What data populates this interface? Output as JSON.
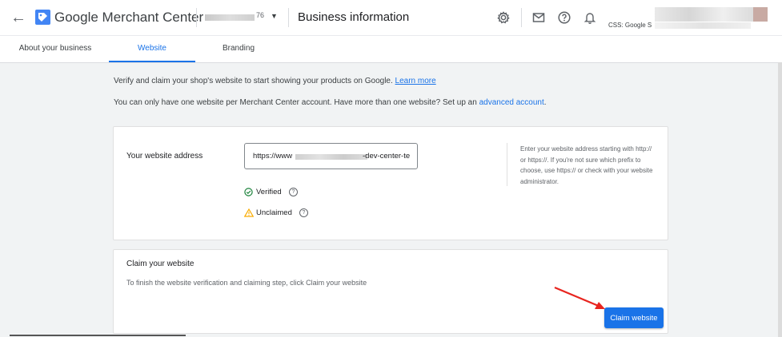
{
  "header": {
    "back_icon": "arrow-back-icon",
    "logo_icon": "merchant-center-logo-icon",
    "brand": "Google Merchant Center",
    "account_suffix": "76",
    "page_title": "Business information",
    "icons": [
      "settings-gear-icon",
      "mail-icon",
      "help-icon",
      "notifications-bell-icon"
    ],
    "profile_label": "CSS: Google S"
  },
  "tabs": [
    {
      "label": "About your business",
      "active": false
    },
    {
      "label": "Website",
      "active": true
    },
    {
      "label": "Branding",
      "active": false
    }
  ],
  "intro": {
    "line1": "Verify and claim your shop's website to start showing your products on Google.",
    "learn_more": "Learn more",
    "line2": "You can only have one website per Merchant Center account. Have more than one website? Set up an",
    "advanced_account": "advanced account",
    "line2_end": "."
  },
  "website_card": {
    "label": "Your website address",
    "url_prefix": "https://www",
    "url_suffix": "-dev-center-te",
    "verified_label": "Verified",
    "unclaimed_label": "Unclaimed",
    "hint": "Enter your website address starting with http:// or https://. If you're not sure which prefix to choose, use https:// or check with your website administrator."
  },
  "claim_card": {
    "title": "Claim your website",
    "description": "To finish the website verification and claiming step, click Claim your website",
    "button_label": "Claim website"
  },
  "colors": {
    "primary": "#1a73e8",
    "verified": "#188038",
    "warning": "#f9ab00",
    "annotation_arrow": "#e8251f"
  }
}
